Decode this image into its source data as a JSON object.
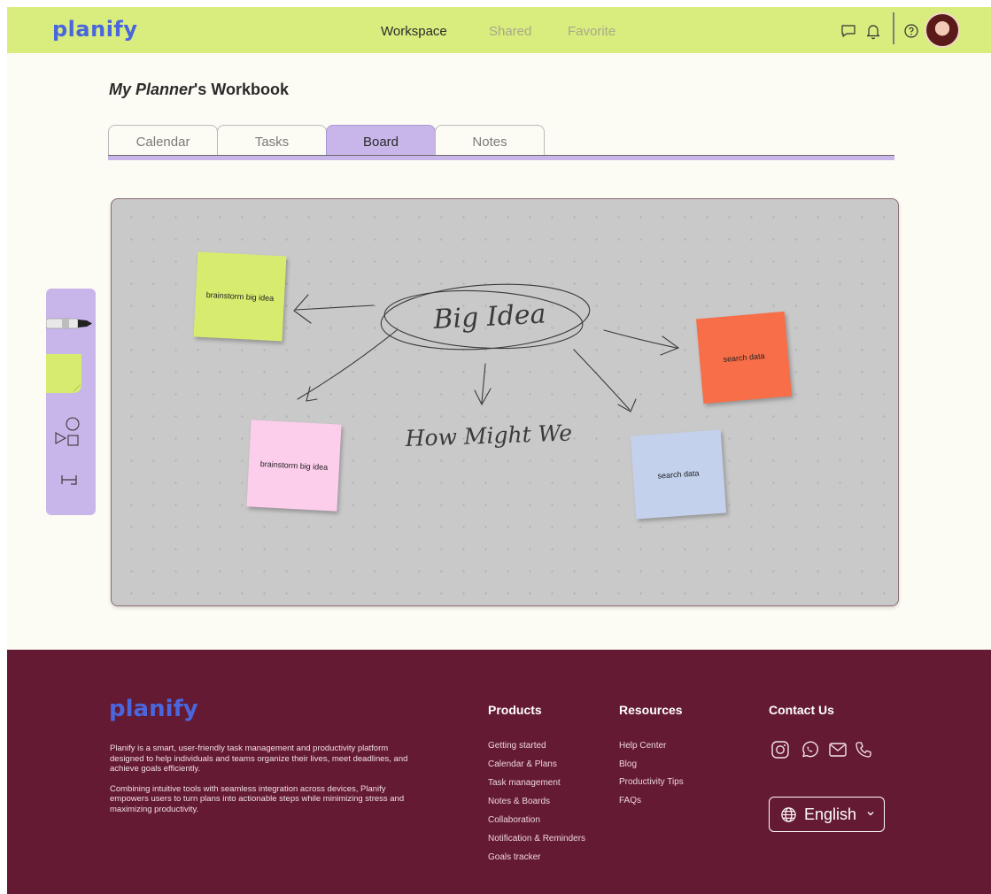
{
  "brand": {
    "logo_text": "planify",
    "logo_color": "#4a66dc"
  },
  "nav": {
    "links": [
      {
        "label": "Workspace",
        "active": true
      },
      {
        "label": "Shared",
        "active": false
      },
      {
        "label": "Favorite",
        "active": false
      }
    ],
    "icons": [
      "chat-icon",
      "bell-icon",
      "help-icon"
    ]
  },
  "workbook": {
    "title_italic": "My Planner",
    "title_rest": "'s Workbook"
  },
  "tabs": [
    {
      "label": "Calendar",
      "active": false
    },
    {
      "label": "Tasks",
      "active": false
    },
    {
      "label": "Board",
      "active": true
    },
    {
      "label": "Notes",
      "active": false
    }
  ],
  "board": {
    "center_text": "Big Idea",
    "how_text": "How Might We",
    "stickies": [
      {
        "text": "brainstorm big idea",
        "color": "#d7ec6f"
      },
      {
        "text": "brainstorm big idea",
        "color": "#fdcdec"
      },
      {
        "text": "search data",
        "color": "#f76e48"
      },
      {
        "text": "search data",
        "color": "#c3d1ed"
      }
    ]
  },
  "toolbar": {
    "tools": [
      "marker-tool-icon",
      "sticky-note-tool-icon",
      "shapes-tool-icon",
      "connector-tool-icon"
    ]
  },
  "footer": {
    "logo_text": "planify",
    "description": [
      "Planify is a smart, user-friendly task management and productivity platform designed to help individuals and teams organize their lives, meet deadlines, and achieve goals efficiently.",
      "Combining intuitive tools with seamless integration across devices, Planify empowers users to turn plans into actionable steps while minimizing stress and maximizing productivity."
    ],
    "products": {
      "heading": "Products",
      "items": [
        "Getting started",
        "Calendar & Plans",
        "Task management",
        "Notes & Boards",
        "Collaboration",
        "Notification & Reminders",
        "Goals tracker"
      ]
    },
    "resources": {
      "heading": "Resources",
      "items": [
        "Help Center",
        "Blog",
        "Productivity Tips",
        "FAQs"
      ]
    },
    "contact": {
      "heading": "Contact Us",
      "icons": [
        "instagram-icon",
        "whatsapp-icon",
        "mail-icon",
        "phone-icon"
      ]
    },
    "language": "English"
  },
  "colors": {
    "nav_bg": "#d9ec7e",
    "tab_active": "#c8b6ea",
    "footer_bg": "#641a32",
    "board_bg": "#c9c9c9"
  }
}
